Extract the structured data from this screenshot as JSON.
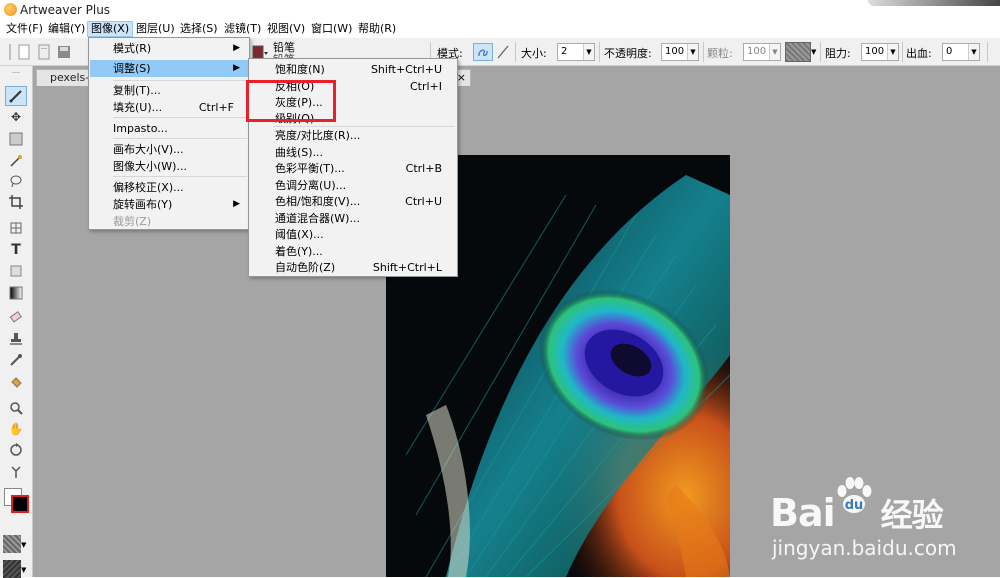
{
  "window": {
    "title": "Artweaver Plus"
  },
  "menubar": [
    {
      "label": "文件(F)"
    },
    {
      "label": "编辑(Y)"
    },
    {
      "label": "图像(X)"
    },
    {
      "label": "图层(U)"
    },
    {
      "label": "选择(S)"
    },
    {
      "label": "滤镜(T)"
    },
    {
      "label": "视图(V)"
    },
    {
      "label": "窗口(W)"
    },
    {
      "label": "帮助(R)"
    }
  ],
  "toolbar": {
    "brush_name": "铅笔",
    "brush_name_2": "铅笔",
    "mode_label": "模式:",
    "size_label": "大小:",
    "size_value": "2",
    "opacity_label": "不透明度:",
    "opacity_value": "100",
    "grain_label": "颗粒:",
    "grain_value": "100",
    "resist_label": "阻力:",
    "resist_value": "100",
    "bleed_label": "出血:",
    "bleed_value": "0"
  },
  "document": {
    "tab_title": "pexels-p",
    "close": "×"
  },
  "image_menu": [
    {
      "label": "模式(R)",
      "shortcut": "",
      "submenu": true
    },
    {
      "label": "调整(S)",
      "shortcut": "",
      "submenu": true,
      "highlighted": true
    },
    {
      "label": "复制(T)...",
      "shortcut": ""
    },
    {
      "label": "填充(U)...",
      "shortcut": "Ctrl+F"
    },
    {
      "label": "Impasto...",
      "shortcut": ""
    },
    {
      "label": "画布大小(V)...",
      "shortcut": ""
    },
    {
      "label": "图像大小(W)...",
      "shortcut": ""
    },
    {
      "label": "偏移校正(X)...",
      "shortcut": ""
    },
    {
      "label": "旋转画布(Y)",
      "shortcut": "",
      "submenu": true
    },
    {
      "label": "裁剪(Z)",
      "shortcut": "",
      "disabled": true
    }
  ],
  "adjust_menu": [
    {
      "label": "饱和度(N)",
      "shortcut": "Shift+Ctrl+U"
    },
    {
      "label": "反相(O)",
      "shortcut": "Ctrl+I"
    },
    {
      "label": "灰度(P)...",
      "shortcut": ""
    },
    {
      "label": "级别(Q)...",
      "shortcut": ""
    },
    {
      "label": "亮度/对比度(R)...",
      "shortcut": ""
    },
    {
      "label": "曲线(S)...",
      "shortcut": ""
    },
    {
      "label": "色彩平衡(T)...",
      "shortcut": "Ctrl+B"
    },
    {
      "label": "色调分离(U)...",
      "shortcut": ""
    },
    {
      "label": "色相/饱和度(V)...",
      "shortcut": "Ctrl+U"
    },
    {
      "label": "通道混合器(W)...",
      "shortcut": ""
    },
    {
      "label": "阈值(X)...",
      "shortcut": ""
    },
    {
      "label": "着色(Y)...",
      "shortcut": ""
    },
    {
      "label": "自动色阶(Z)",
      "shortcut": "Shift+Ctrl+L"
    }
  ],
  "watermark": {
    "brand": "Bai",
    "brand2": "经验",
    "url": "jingyan.baidu.com"
  },
  "colors": {
    "menu_highlight": "#91c9f7",
    "annotation_box": "#e8202a",
    "workspace": "#a5a5a5"
  }
}
